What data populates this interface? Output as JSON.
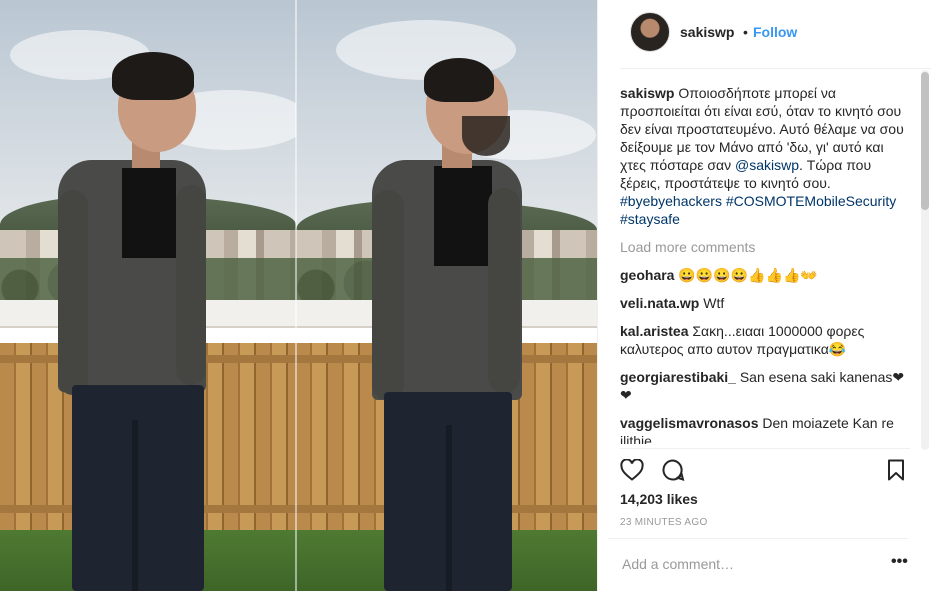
{
  "post": {
    "author": "sakiswp",
    "separator": "•",
    "follow_label": "Follow",
    "caption_text": "Οποιοσδήποτε μπορεί να προσποιείται ότι είναι εσύ, όταν το κινητό σου δεν είναι προστατευμένο. Αυτό θέλαμε να σου δείξουμε με τον Μάνο από 'δω, γι' αυτό και χτες πόσταρε σαν ",
    "caption_mention": "@sakiswp",
    "caption_tail": ". Τώρα που ξέρεις, προστάτεψε το κινητό σου.",
    "hashtag_1": "#byebyehackers",
    "hashtag_2": "#COSMOTEMobileSecurity",
    "hashtag_3": "#staysafe",
    "load_more": "Load more comments",
    "likes": "14,203 likes",
    "time_ago": "23 MINUTES AGO",
    "comment_placeholder": "Add a comment…",
    "options_label": "•••"
  },
  "comments": [
    {
      "user": "geohara",
      "text": "😀😀😀😀👍👍👍👐"
    },
    {
      "user": "veli.nata.wp",
      "text": "Wtf"
    },
    {
      "user": "kal.aristea",
      "text": "Σακη...ειααι 1000000 φορες καλυτερος απο αυτον πραγματικα😂"
    },
    {
      "user": "georgiarestibaki_",
      "text": "San esena saki kanenas❤❤"
    },
    {
      "user": "vaggelismavronasos",
      "text": "Den moiazete Kan re ilithie"
    }
  ],
  "icons": [
    "heart-icon",
    "comment-icon",
    "bookmark-icon"
  ],
  "colors": {
    "link": "#3897f0",
    "tag": "#003569",
    "muted": "#999999"
  }
}
